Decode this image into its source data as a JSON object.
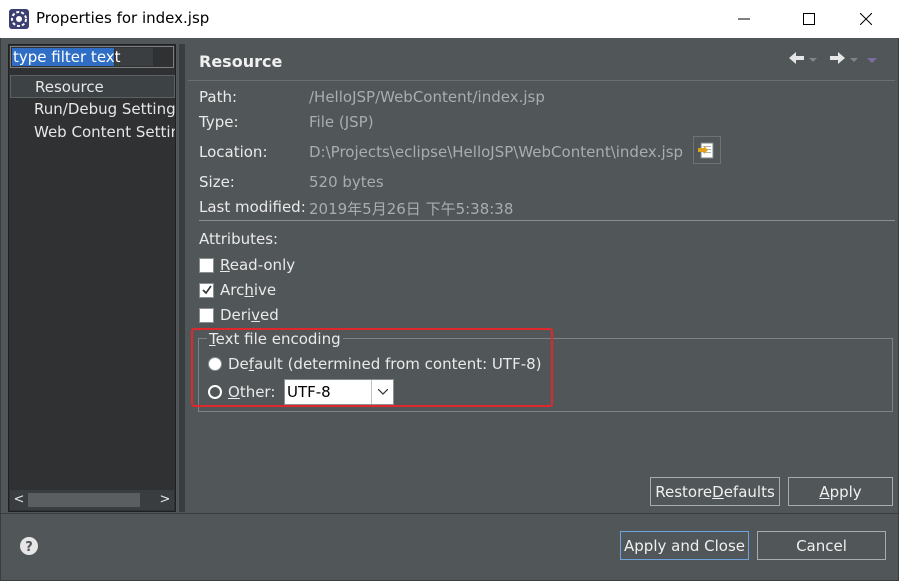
{
  "window": {
    "title": "Properties for index.jsp"
  },
  "filter": {
    "placeholder": "type filter text"
  },
  "tree": {
    "items": [
      {
        "label": "Resource",
        "selected": true
      },
      {
        "label": "Run/Debug Settings"
      },
      {
        "label": "Web Content Settings"
      }
    ]
  },
  "page": {
    "title": "Resource"
  },
  "props": {
    "path_label": "Path:",
    "path_value": "/HelloJSP/WebContent/index.jsp",
    "type_label": "Type:",
    "type_value": "File  (JSP)",
    "location_label": "Location:",
    "location_value": "D:\\Projects\\eclipse\\HelloJSP\\WebContent\\index.jsp",
    "size_label": "Size:",
    "size_value": "520  bytes",
    "modified_label": "Last modified:",
    "modified_value": "2019年5月26日 下午5:38:38"
  },
  "attributes": {
    "heading": "Attributes:",
    "readonly": {
      "pre": "",
      "u": "R",
      "post": "ead-only",
      "checked": false
    },
    "archive": {
      "pre": "Arc",
      "u": "h",
      "post": "ive",
      "checked": true
    },
    "derived": {
      "pre": "Deri",
      "u": "v",
      "post": "ed",
      "checked": false
    }
  },
  "encoding": {
    "legend_u": "T",
    "legend_rest": "ext file encoding",
    "default_pre": "De",
    "default_u": "f",
    "default_post": "ault (determined from content: UTF-8)",
    "other_u": "O",
    "other_rest": "ther:",
    "selected_value": "UTF-8"
  },
  "buttons": {
    "restore_pre": "Restore ",
    "restore_u": "D",
    "restore_post": "efaults",
    "apply_u": "A",
    "apply_post": "pply",
    "apply_close": "Apply and Close",
    "cancel": "Cancel"
  },
  "colors": {
    "highlight": "#e0282c",
    "selection": "#2f6ec4",
    "background": "#515658"
  }
}
